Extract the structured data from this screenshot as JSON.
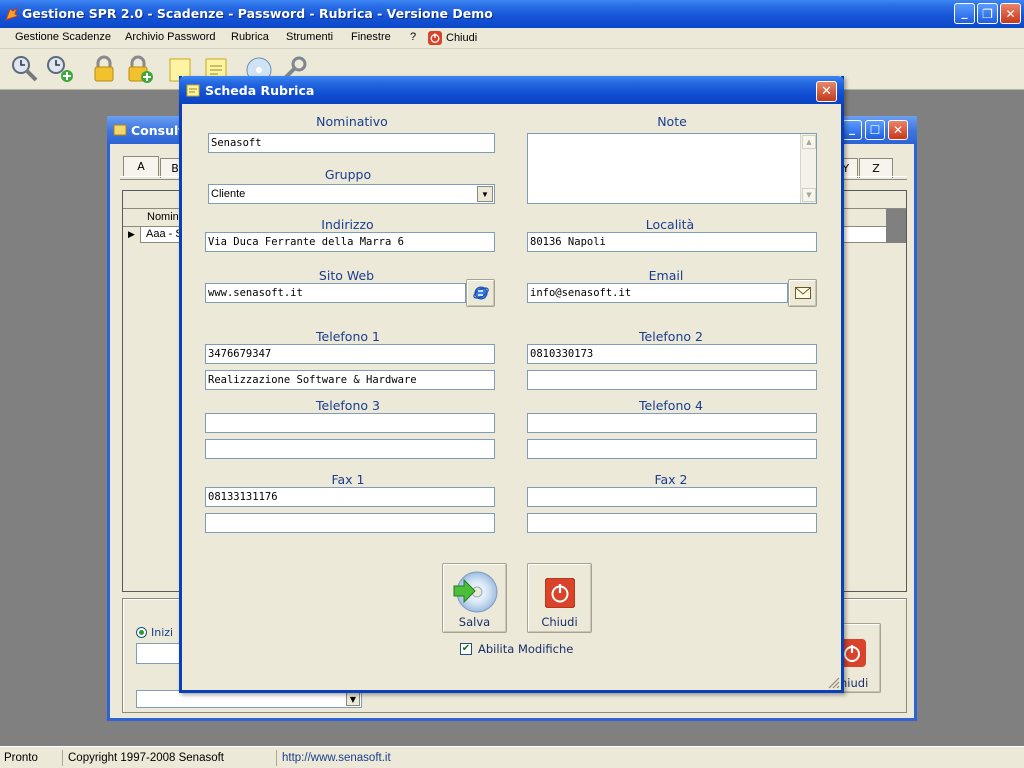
{
  "window": {
    "title": "Gestione SPR 2.0 - Scadenze - Password - Rubrica - Versione Demo",
    "minimize": "_",
    "maximize": "❐",
    "close": "✕"
  },
  "menu": {
    "items": [
      "Gestione Scadenze",
      "Archivio Password",
      "Rubrica",
      "Strumenti",
      "Finestre",
      "?",
      "Chiudi"
    ]
  },
  "toolbar": {
    "icons": [
      "scadenze-icon",
      "add-scadenza-icon",
      "lock-icon",
      "add-lock-icon",
      "note-icon",
      "note-edit-icon",
      "cd-icon",
      "wrench-icon"
    ]
  },
  "background_window": {
    "title": "Consulta",
    "tabs": [
      "A",
      "B",
      "XY",
      "Z"
    ],
    "column_header": "Nomin",
    "row_text": "Aaa - S",
    "radio_label": "Inizi",
    "close_button": "hiudi"
  },
  "dialog": {
    "title": "Scheda Rubrica",
    "close": "✕",
    "nominativo_label": "Nominativo",
    "nominativo_value": "Senasoft",
    "note_label": "Note",
    "note_value": "",
    "gruppo_label": "Gruppo",
    "gruppo_value": "Cliente",
    "indirizzo_label": "Indirizzo",
    "indirizzo_value": "Via Duca Ferrante della Marra 6",
    "localita_label": "Località",
    "localita_value": "80136 Napoli",
    "sitoweb_label": "Sito Web",
    "sitoweb_value": "www.senasoft.it",
    "email_label": "Email",
    "email_value": "info@senasoft.it",
    "tel1_label": "Telefono 1",
    "tel1_value": "3476679347",
    "tel1_note": "Realizzazione Software & Hardware",
    "tel2_label": "Telefono 2",
    "tel2_value": "0810330173",
    "tel2_note": "",
    "tel3_label": "Telefono 3",
    "tel3_value": "",
    "tel3_note": "",
    "tel4_label": "Telefono 4",
    "tel4_value": "",
    "tel4_note": "",
    "fax1_label": "Fax 1",
    "fax1_value": "08133131176",
    "fax1_note": "",
    "fax2_label": "Fax 2",
    "fax2_value": "",
    "fax2_note": "",
    "save_label": "Salva",
    "close_label": "Chiudi",
    "enable_edit_label": "Abilita Modifiche",
    "enable_edit_checked": true
  },
  "status": {
    "state": "Pronto",
    "copyright": "Copyright 1997-2008 Senasoft",
    "url": "http://www.senasoft.it"
  },
  "colors": {
    "titlebar_blue": "#0c49c9",
    "dialog_border": "#0a3fb8",
    "label_blue": "#1a3d8f",
    "window_face": "#ece9d8",
    "close_red": "#c23a1c"
  }
}
